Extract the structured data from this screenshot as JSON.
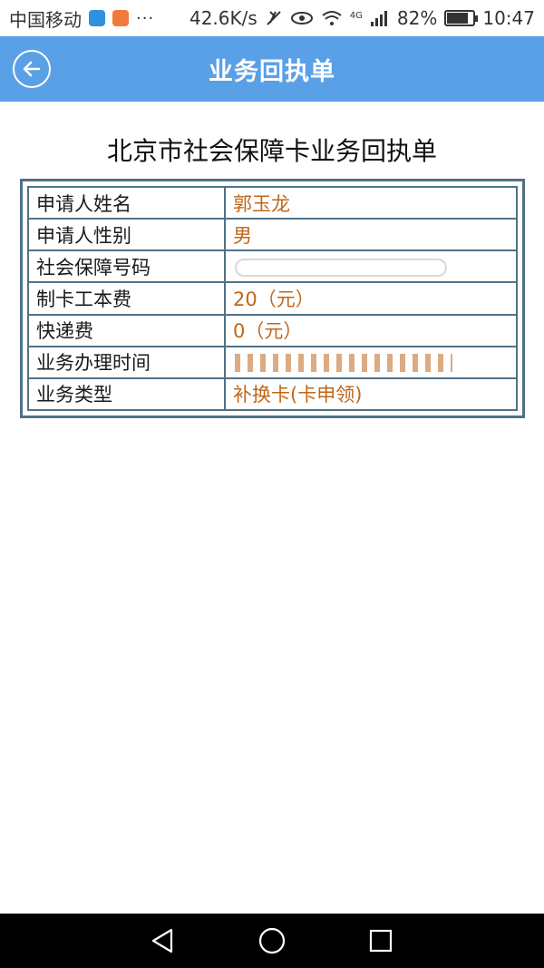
{
  "status_bar": {
    "carrier": "中国移动",
    "dots": "···",
    "speed": "42.6K/s",
    "network": "4G",
    "battery": "82%",
    "battery_level": 0.82,
    "time": "10:47"
  },
  "header": {
    "title": "业务回执单"
  },
  "receipt": {
    "title": "北京市社会保障卡业务回执单",
    "rows": [
      {
        "label": "申请人姓名",
        "value": "郭玉龙"
      },
      {
        "label": "申请人性别",
        "value": "男"
      },
      {
        "label": "社会保障号码",
        "value": ""
      },
      {
        "label": "制卡工本费",
        "value": "20（元）"
      },
      {
        "label": "快递费",
        "value": "0（元）"
      },
      {
        "label": "业务办理时间",
        "value": ""
      },
      {
        "label": "业务类型",
        "value": "补换卡(卡申领)"
      }
    ]
  },
  "colors": {
    "header_bg": "#5aa0e6",
    "table_border": "#4f7286",
    "value_text": "#c0661a"
  },
  "icons": {
    "back": "back-arrow-icon",
    "nav_back": "triangle-back-icon",
    "nav_home": "circle-home-icon",
    "nav_recent": "square-recent-icon"
  }
}
